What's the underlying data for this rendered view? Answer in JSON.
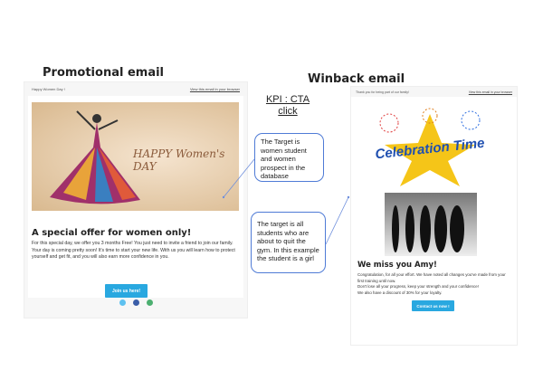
{
  "labels": {
    "promo": "Promotional email",
    "winback": "Winback email",
    "kpi_line1": "KPI : CTA",
    "kpi_line2": "click"
  },
  "promo": {
    "header_left": "Happy Women Day !",
    "header_link": "View this email in your browser",
    "banner_text": "HAPPY Women's DAY",
    "heading": "A special offer for women only!",
    "para1": "For this special day, we offer you 3 months Free! You just need to invite a friend to join our family.",
    "para2": "Your day is coming pretty soon! It's time to start your new life. With us you will learn how to protect yourself and get fit, and you will also earn more confidence in you.",
    "cta": "Join us here!",
    "social": [
      "twitter-icon",
      "facebook-icon",
      "link-icon"
    ]
  },
  "winback": {
    "header_left": "Thank you for being part of our family!",
    "header_link": "View this email in your browser",
    "banner_text": "Celebration Time",
    "heading": "We miss you Amy!",
    "para1": "Congratulation, for all your effort. We have noted all changes you've made from your first training until now.",
    "para2": "Don't lose all your progress, keep your strength and your confidence!",
    "para3": "We also have a discount of 30% for your loyalty.",
    "cta": "Contact us now !"
  },
  "notes": {
    "box1": "The Target is women student and women prospect in the database",
    "box2": "The target is all students who are about to quit the gym. In this example the student is a girl"
  },
  "colors": {
    "cta": "#29a8e0",
    "box_border": "#4f7bd6"
  }
}
